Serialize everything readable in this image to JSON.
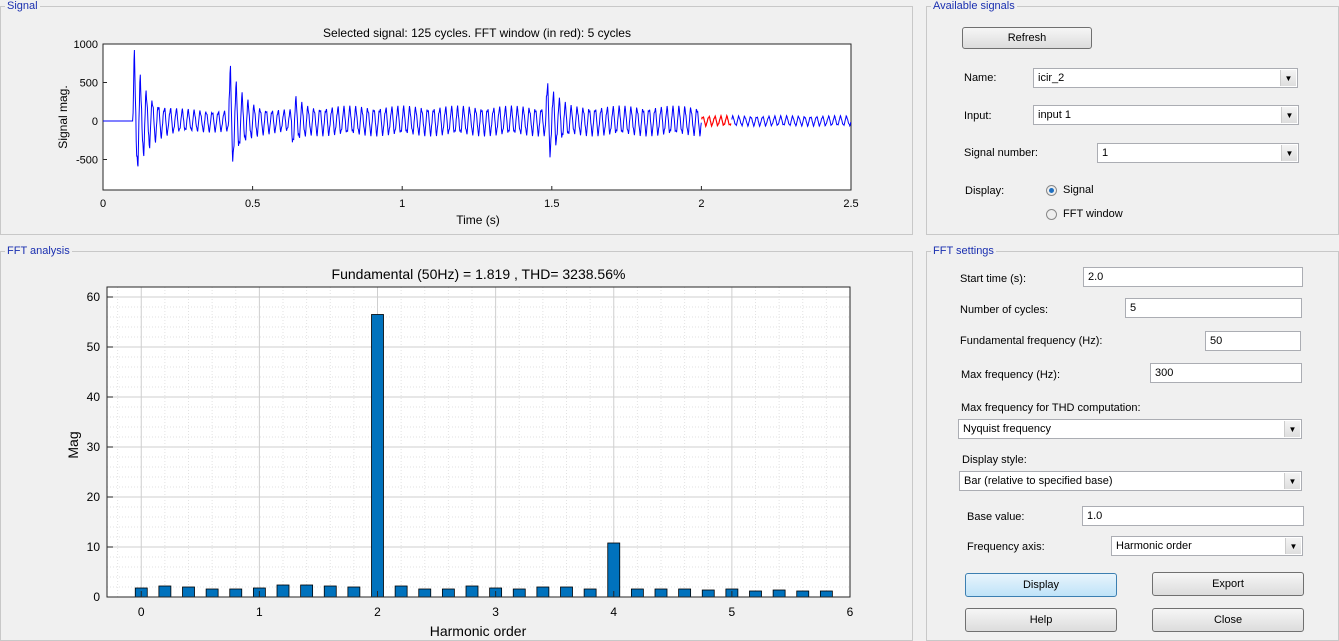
{
  "signal_panel": {
    "title": "Signal",
    "plot_title": "Selected signal: 125 cycles. FFT window (in red): 5 cycles",
    "ylabel": "Signal mag.",
    "xlabel": "Time (s)",
    "xticks": [
      "0",
      "0.5",
      "1",
      "1.5",
      "2",
      "2.5"
    ],
    "yticks": [
      "1000",
      "500",
      "0",
      "-500"
    ],
    "signal_color": "#0000ff",
    "window_color": "#ff0000"
  },
  "fft_panel": {
    "title": "FFT analysis",
    "plot_title": "Fundamental (50Hz) = 1.819 , THD= 3238.56%"
  },
  "chart_data": {
    "type": "bar",
    "title": "Fundamental (50Hz) = 1.819 , THD= 3238.56%",
    "xlabel": "Harmonic order",
    "ylabel": "Mag",
    "xlim": [
      -0.29,
      6
    ],
    "ylim": [
      0,
      62
    ],
    "grid": true,
    "bar_color": "#0072bd",
    "x": [
      0,
      0.2,
      0.4,
      0.6,
      0.8,
      1.0,
      1.2,
      1.4,
      1.6,
      1.8,
      2.0,
      2.2,
      2.4,
      2.6,
      2.8,
      3.0,
      3.2,
      3.4,
      3.6,
      3.8,
      4.0,
      4.2,
      4.4,
      4.6,
      4.8,
      5.0,
      5.2,
      5.4,
      5.6,
      5.8
    ],
    "values": [
      1.8,
      2.2,
      2.0,
      1.6,
      1.6,
      1.8,
      2.4,
      2.4,
      2.2,
      2.0,
      56.5,
      2.2,
      1.6,
      1.6,
      2.2,
      1.8,
      1.6,
      2.0,
      2.0,
      1.6,
      10.8,
      1.6,
      1.6,
      1.6,
      1.4,
      1.6,
      1.2,
      1.4,
      1.2,
      1.2
    ],
    "xticks": [
      "0",
      "1",
      "2",
      "3",
      "4",
      "5",
      "6"
    ],
    "yticks": [
      "0",
      "10",
      "20",
      "30",
      "40",
      "50",
      "60"
    ]
  },
  "available_signals": {
    "title": "Available signals",
    "refresh": "Refresh",
    "name_label": "Name:",
    "name_value": "icir_2",
    "input_label": "Input:",
    "input_value": "input 1",
    "signum_label": "Signal number:",
    "signum_value": "1",
    "display_label": "Display:",
    "opt_signal": "Signal",
    "opt_fft": "FFT window",
    "selected": "Signal"
  },
  "fft_settings": {
    "title": "FFT settings",
    "start_label": "Start time (s):",
    "start_value": "2.0",
    "cycles_label": "Number of cycles:",
    "cycles_value": "5",
    "fund_label": "Fundamental frequency (Hz):",
    "fund_value": "50",
    "maxf_label": "Max frequency (Hz):",
    "maxf_value": "300",
    "thd_label": "Max frequency for THD computation:",
    "thd_value": "Nyquist frequency",
    "style_label": "Display style:",
    "style_value": "Bar (relative to specified base)",
    "base_label": "Base value:",
    "base_value": "1.0",
    "faxis_label": "Frequency axis:",
    "faxis_value": "Harmonic order",
    "display_btn": "Display",
    "export_btn": "Export",
    "help_btn": "Help",
    "close_btn": "Close"
  }
}
